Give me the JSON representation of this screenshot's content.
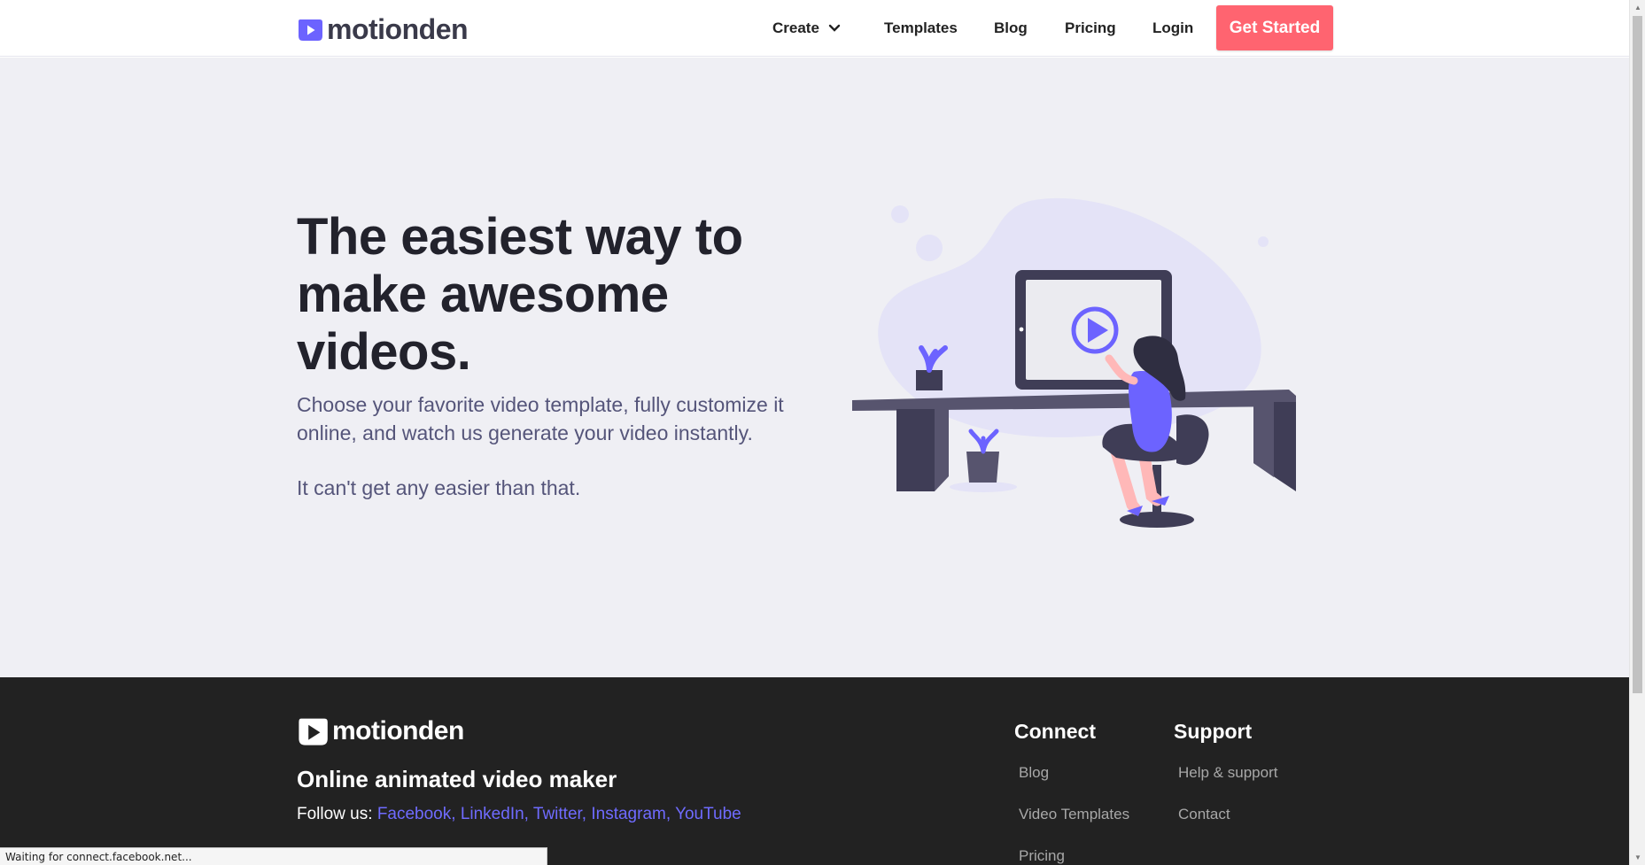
{
  "header": {
    "logo_text": "motionden",
    "nav": {
      "create": "Create",
      "templates": "Templates",
      "blog": "Blog",
      "pricing": "Pricing",
      "login": "Login"
    },
    "cta": "Get Started"
  },
  "hero": {
    "title": "The easiest way to make awesome videos.",
    "subtitle": "Choose your favorite video template, fully customize it online, and watch us generate your video instantly.",
    "subtitle2": "It can't get any easier than that."
  },
  "footer": {
    "logo_text": "motionden",
    "tagline": "Online animated video maker",
    "follow_label": "Follow us:",
    "social": {
      "facebook": "Facebook,",
      "linkedin": "LinkedIn,",
      "twitter": "Twitter,",
      "instagram": "Instagram,",
      "youtube": "YouTube"
    },
    "connect": {
      "title": "Connect",
      "links": [
        "Blog",
        "Video Templates",
        "Pricing"
      ]
    },
    "support": {
      "title": "Support",
      "links": [
        "Help & support",
        "Contact"
      ]
    }
  },
  "status_text": "Waiting for connect.facebook.net...",
  "colors": {
    "accent": "#6c63ff",
    "cta": "#ff6470",
    "hero_bg": "#efeff4",
    "footer_bg": "#222222"
  },
  "icons": [
    "logo-mark-icon",
    "chevron-down-icon",
    "play-icon"
  ]
}
